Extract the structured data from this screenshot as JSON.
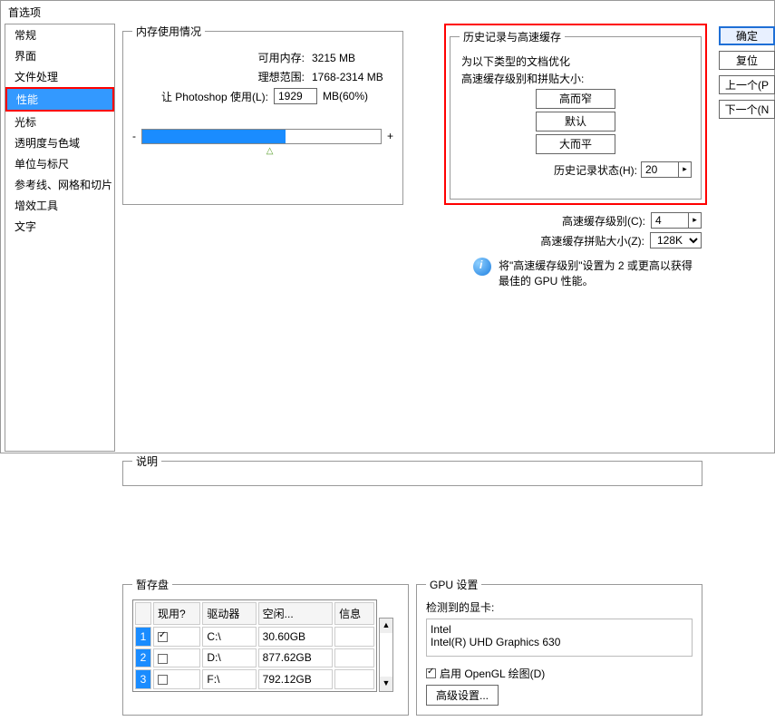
{
  "dialog_title": "首选项",
  "sidebar": {
    "items": [
      "常规",
      "界面",
      "文件处理",
      "性能",
      "光标",
      "透明度与色域",
      "单位与标尺",
      "参考线、网格和切片",
      "增效工具",
      "文字"
    ],
    "selected_index": 3
  },
  "buttons": {
    "ok": "确定",
    "reset": "复位",
    "prev": "上一个(P",
    "next": "下一个(N"
  },
  "memory": {
    "legend": "内存使用情况",
    "avail_label": "可用内存:",
    "avail_value": "3215 MB",
    "ideal_label": "理想范围:",
    "ideal_value": "1768-2314 MB",
    "use_label": "让 Photoshop 使用(L):",
    "use_value": "1929",
    "use_suffix": "MB(60%)",
    "minus": "-",
    "plus": "+"
  },
  "history": {
    "legend": "历史记录与高速缓存",
    "sub1": "为以下类型的文档优化",
    "sub2": "高速缓存级别和拼贴大小:",
    "btn_tall": "高而窄",
    "btn_default": "默认",
    "btn_wide": "大而平",
    "states_label": "历史记录状态(H):",
    "states_value": "20"
  },
  "cache": {
    "level_label": "高速缓存级别(C):",
    "level_value": "4",
    "tile_label": "高速缓存拼贴大小(Z):",
    "tile_value": "128K",
    "hint": "将\"高速缓存级别\"设置为 2 或更高以获得最佳的 GPU 性能。"
  },
  "scratch": {
    "legend": "暂存盘",
    "cols": [
      "",
      "现用?",
      "驱动器",
      "空闲...",
      "信息"
    ],
    "rows": [
      {
        "n": "1",
        "active": true,
        "drive": "C:\\",
        "free": "30.60GB",
        "info": ""
      },
      {
        "n": "2",
        "active": false,
        "drive": "D:\\",
        "free": "877.62GB",
        "info": ""
      },
      {
        "n": "3",
        "active": false,
        "drive": "F:\\",
        "free": "792.12GB",
        "info": ""
      }
    ]
  },
  "gpu": {
    "legend": "GPU 设置",
    "detected_label": "检测到的显卡:",
    "line1": "Intel",
    "line2": "Intel(R) UHD Graphics 630",
    "enable_label": "启用 OpenGL 绘图(D)",
    "adv_btn": "高级设置..."
  },
  "desc": {
    "legend": "说明"
  }
}
